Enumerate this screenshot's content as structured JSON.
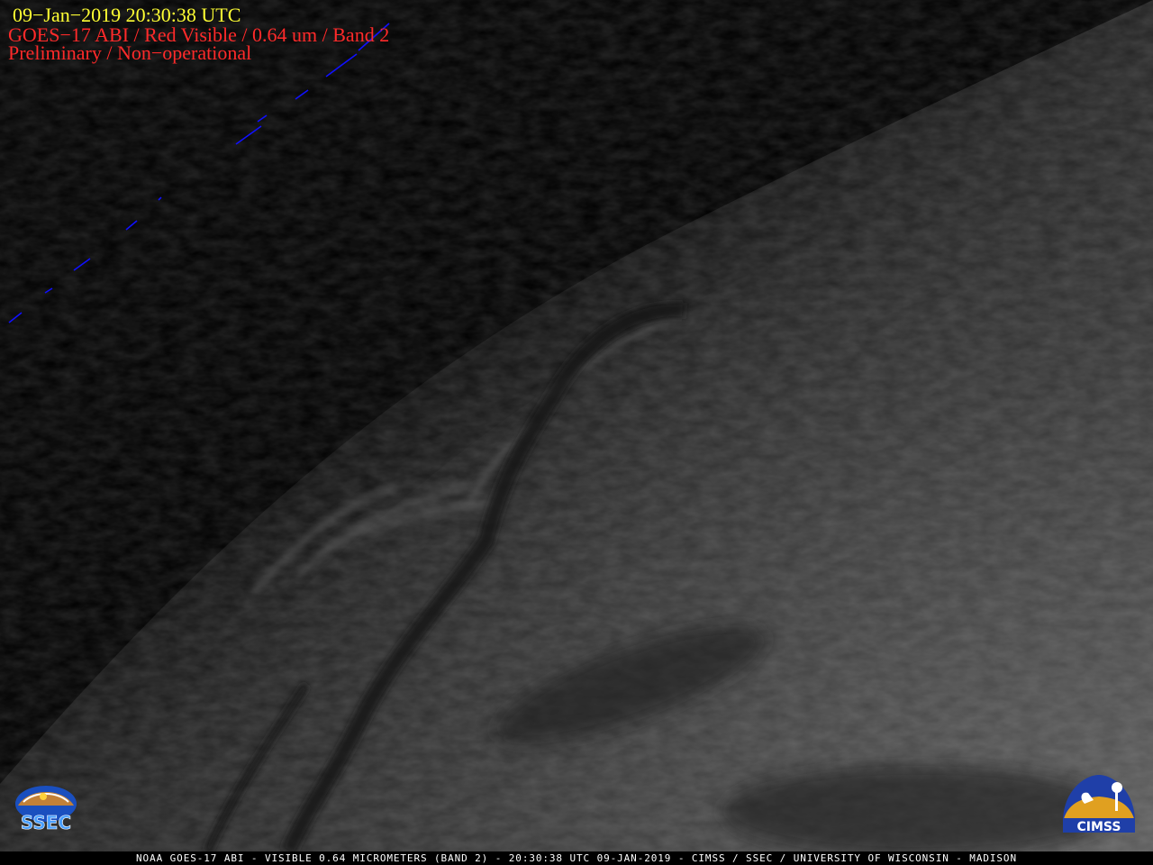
{
  "header": {
    "timestamp": "09−Jan−2019  20:30:38 UTC",
    "line1": "GOES−17 ABI / Red Visible / 0.64 um / Band 2",
    "line2": "Preliminary / Non−operational"
  },
  "footer": {
    "caption": "NOAA GOES-17 ABI - VISIBLE 0.64 MICROMETERS (BAND 2) - 20:30:38 UTC 09-JAN-2019 - CIMSS / SSEC / UNIVERSITY OF WISCONSIN - MADISON"
  },
  "logos": {
    "left": "SSEC",
    "right": "CIMSS"
  },
  "colors": {
    "timestamp": "#ffff33",
    "subtitle": "#ff2a2a",
    "coastline": "#0000ff",
    "background": "#000000"
  },
  "icons": {
    "left_logo": "ssec-logo",
    "right_logo": "cimss-logo"
  }
}
